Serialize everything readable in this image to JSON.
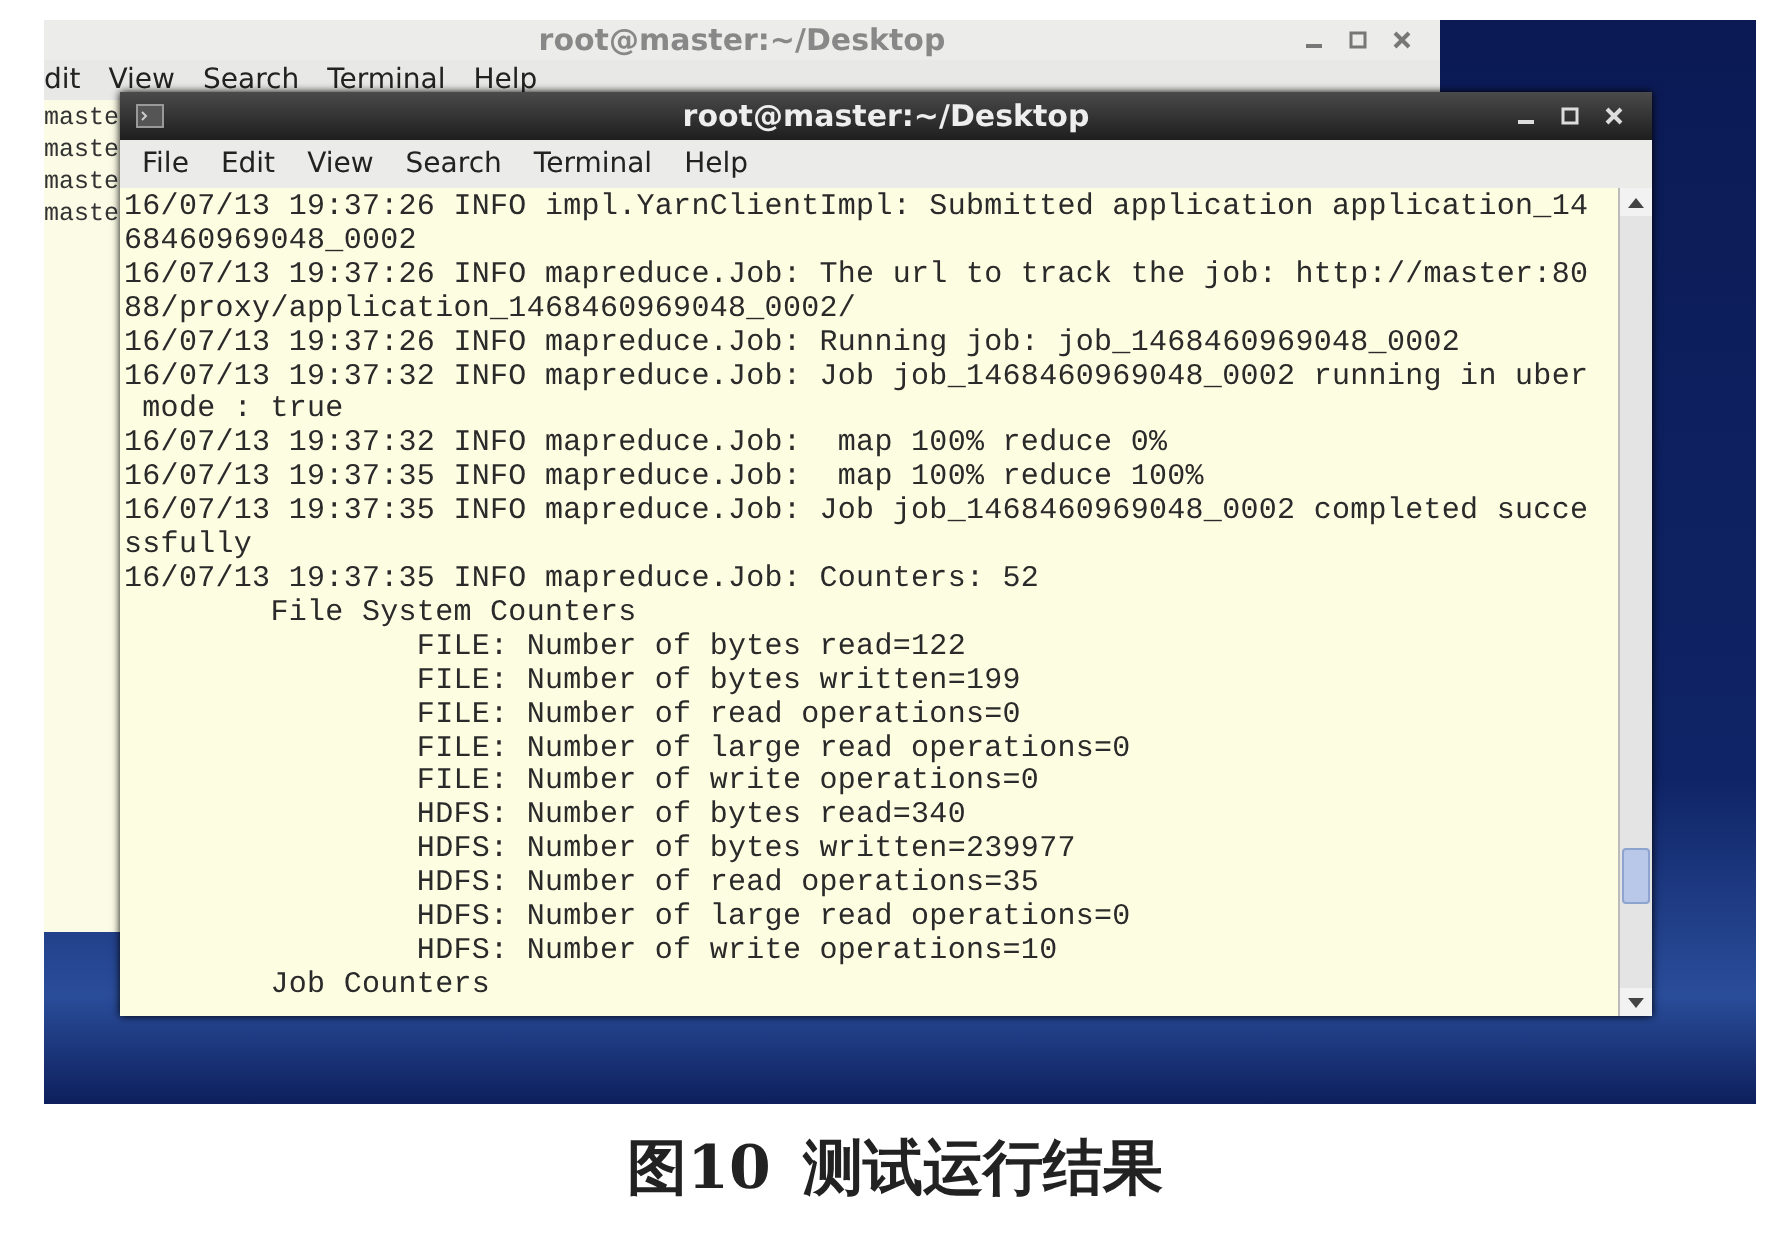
{
  "back_window": {
    "title": "root@master:~/Desktop",
    "menu": [
      "dit",
      "View",
      "Search",
      "Terminal",
      "Help"
    ],
    "lines": [
      "maste",
      "maste",
      "maste",
      "maste"
    ]
  },
  "front_window": {
    "title": "root@master:~/Desktop",
    "menu": [
      "File",
      "Edit",
      "View",
      "Search",
      "Terminal",
      "Help"
    ],
    "lines": [
      "16/07/13 19:37:26 INFO impl.YarnClientImpl: Submitted application application_14",
      "68460969048_0002",
      "16/07/13 19:37:26 INFO mapreduce.Job: The url to track the job: http://master:80",
      "88/proxy/application_1468460969048_0002/",
      "16/07/13 19:37:26 INFO mapreduce.Job: Running job: job_1468460969048_0002",
      "16/07/13 19:37:32 INFO mapreduce.Job: Job job_1468460969048_0002 running in uber",
      " mode : true",
      "16/07/13 19:37:32 INFO mapreduce.Job:  map 100% reduce 0%",
      "16/07/13 19:37:35 INFO mapreduce.Job:  map 100% reduce 100%",
      "16/07/13 19:37:35 INFO mapreduce.Job: Job job_1468460969048_0002 completed succe",
      "ssfully",
      "16/07/13 19:37:35 INFO mapreduce.Job: Counters: 52",
      "        File System Counters",
      "                FILE: Number of bytes read=122",
      "                FILE: Number of bytes written=199",
      "                FILE: Number of read operations=0",
      "                FILE: Number of large read operations=0",
      "                FILE: Number of write operations=0",
      "                HDFS: Number of bytes read=340",
      "                HDFS: Number of bytes written=239977",
      "                HDFS: Number of read operations=35",
      "                HDFS: Number of large read operations=0",
      "                HDFS: Number of write operations=10",
      "        Job Counters"
    ]
  },
  "caption": {
    "label": "图10",
    "text": "测试运行结果"
  }
}
